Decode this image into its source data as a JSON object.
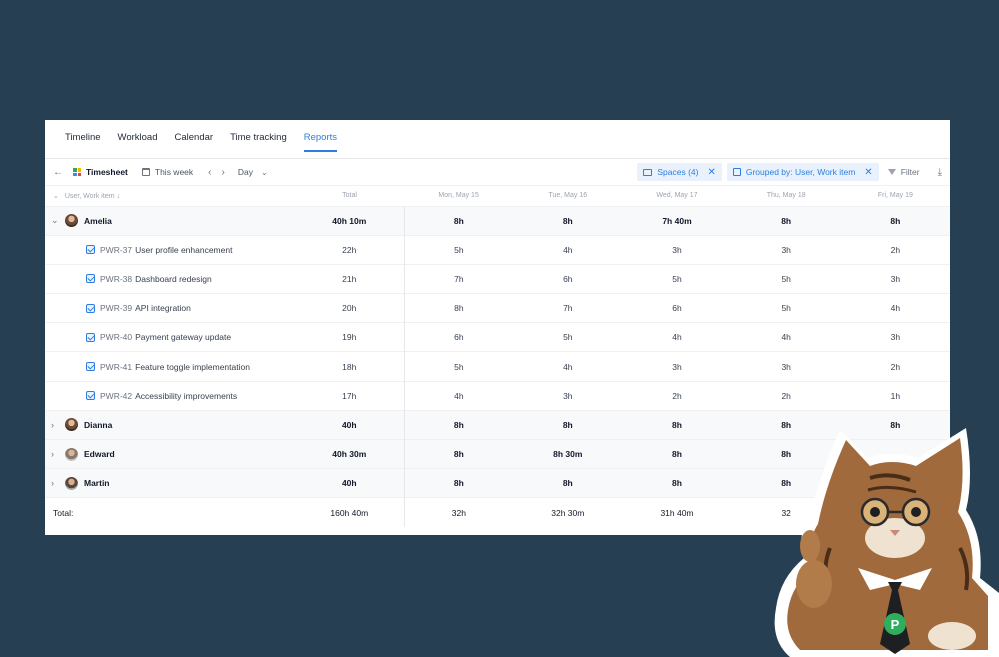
{
  "tabs": [
    {
      "label": "Timeline"
    },
    {
      "label": "Workload"
    },
    {
      "label": "Calendar"
    },
    {
      "label": "Time tracking"
    },
    {
      "label": "Reports",
      "active": true
    }
  ],
  "toolbar": {
    "title": "Timesheet",
    "range": "This week",
    "granularity": "Day",
    "spaces_chip": "Spaces (4)",
    "grouped_chip": "Grouped by: User, Work item",
    "filter_label": "Filter"
  },
  "table": {
    "headers": {
      "name": "User, Work item ↓",
      "total": "Total",
      "days": [
        "Mon, May 15",
        "Tue, May 16",
        "Wed, May 17",
        "Thu, May 18",
        "Fri, May 19"
      ]
    },
    "amelia": {
      "name": "Amelia",
      "total": "40h 10m",
      "days": [
        "8h",
        "8h",
        "7h 40m",
        "8h",
        "8h"
      ],
      "items": [
        {
          "key": "PWR-37",
          "title": "User profile enhancement",
          "total": "22h",
          "days": [
            "5h",
            "4h",
            "3h",
            "3h",
            "2h"
          ]
        },
        {
          "key": "PWR-38",
          "title": "Dashboard redesign",
          "total": "21h",
          "days": [
            "7h",
            "6h",
            "5h",
            "5h",
            "3h"
          ]
        },
        {
          "key": "PWR-39",
          "title": "API integration",
          "total": "20h",
          "days": [
            "8h",
            "7h",
            "6h",
            "5h",
            "4h"
          ]
        },
        {
          "key": "PWR-40",
          "title": "Payment gateway update",
          "total": "19h",
          "days": [
            "6h",
            "5h",
            "4h",
            "4h",
            "3h"
          ]
        },
        {
          "key": "PWR-41",
          "title": "Feature toggle implementation",
          "total": "18h",
          "days": [
            "5h",
            "4h",
            "3h",
            "3h",
            "2h"
          ]
        },
        {
          "key": "PWR-42",
          "title": "Accessibility improvements",
          "total": "17h",
          "days": [
            "4h",
            "3h",
            "2h",
            "2h",
            "1h"
          ]
        }
      ]
    },
    "users": [
      {
        "name": "Dianna",
        "total": "40h",
        "days": [
          "8h",
          "8h",
          "8h",
          "8h",
          "8h"
        ]
      },
      {
        "name": "Edward",
        "total": "40h 30m",
        "days": [
          "8h",
          "8h 30m",
          "8h",
          "8h",
          ""
        ]
      },
      {
        "name": "Martin",
        "total": "40h",
        "days": [
          "8h",
          "8h",
          "8h",
          "8h",
          ""
        ]
      }
    ],
    "totals": {
      "label": "Total:",
      "total": "160h 40m",
      "days": [
        "32h",
        "32h 30m",
        "31h 40m",
        "32",
        ""
      ]
    }
  },
  "colors": {
    "accent": "#2d7ee0",
    "background": "#263f52"
  },
  "sticker": {
    "icon": "cat-mascot-thumbs-up",
    "badge_letter": "P"
  }
}
